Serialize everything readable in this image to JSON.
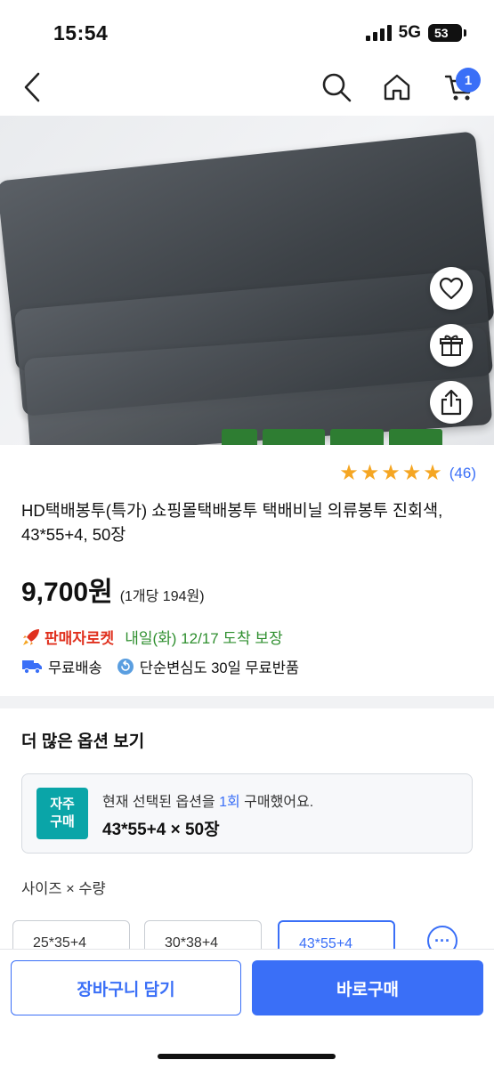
{
  "status_bar": {
    "time": "15:54",
    "network": "5G",
    "battery": "53"
  },
  "nav": {
    "back_icon": "chevron-left-icon",
    "search_icon": "search-icon",
    "home_icon": "home-icon",
    "cart_icon": "cart-icon",
    "cart_badge": "1"
  },
  "image_actions": [
    "heart-icon",
    "gift-icon",
    "share-icon"
  ],
  "rating": {
    "stars": 5,
    "count": "(46)"
  },
  "product": {
    "title": "HD택배봉투(특가) 쇼핑몰택배봉투 택배비닐 의류봉투 진회색, 43*55+4, 50장",
    "price": "9,700원",
    "unit_price": "(1개당 194원)"
  },
  "delivery": {
    "rocket_label": "판매자로켓",
    "rocket_date": "내일(화) 12/17 도착 보장",
    "free_shipping": "무료배송",
    "free_return": "단순변심도 30일 무료반품"
  },
  "options": {
    "section_title": "더 많은 옵션 보기",
    "frequent_badge_line1": "자주",
    "frequent_badge_line2": "구매",
    "history_prefix": "현재 선택된 옵션을 ",
    "history_count": "1회",
    "history_suffix": " 구매했어요.",
    "selected_option": "43*55+4 × 50장",
    "size_label": "사이즈 × 수량",
    "chips": [
      "25*35+4",
      "30*38+4",
      "43*55+4"
    ],
    "more_label": "···"
  },
  "actions": {
    "add_to_cart": "장바구니 담기",
    "buy_now": "바로구매"
  },
  "colors": {
    "accent": "#3a6ff7",
    "rocket": "#e0301e",
    "delivery": "#2f8f2f",
    "badge": "#0aa5a8"
  }
}
